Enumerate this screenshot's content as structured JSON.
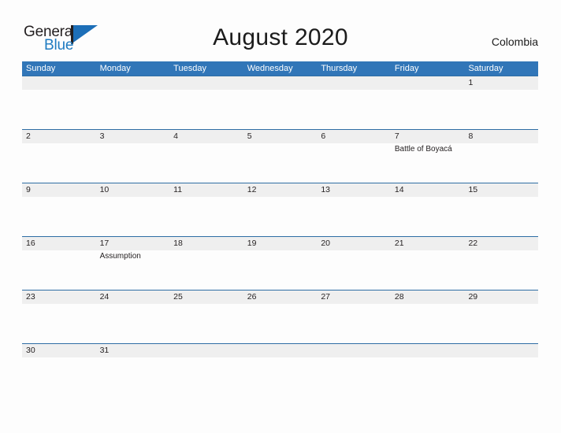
{
  "brand": {
    "name_part1": "General",
    "name_part2": "Blue",
    "logo_icon": "general-blue-flag-logo",
    "accent_color": "#1d6fb8"
  },
  "header": {
    "title": "August 2020",
    "country": "Colombia"
  },
  "calendar": {
    "month": "August",
    "year": "2020",
    "header_bg": "#3176b8",
    "date_strip_bg": "#efefef",
    "row_border_color": "#2e6da4",
    "weekdays": [
      "Sunday",
      "Monday",
      "Tuesday",
      "Wednesday",
      "Thursday",
      "Friday",
      "Saturday"
    ],
    "weeks": [
      {
        "dates": [
          "",
          "",
          "",
          "",
          "",
          "",
          "1"
        ],
        "events": [
          "",
          "",
          "",
          "",
          "",
          "",
          ""
        ]
      },
      {
        "dates": [
          "2",
          "3",
          "4",
          "5",
          "6",
          "7",
          "8"
        ],
        "events": [
          "",
          "",
          "",
          "",
          "",
          "Battle of Boyacá",
          ""
        ]
      },
      {
        "dates": [
          "9",
          "10",
          "11",
          "12",
          "13",
          "14",
          "15"
        ],
        "events": [
          "",
          "",
          "",
          "",
          "",
          "",
          ""
        ]
      },
      {
        "dates": [
          "16",
          "17",
          "18",
          "19",
          "20",
          "21",
          "22"
        ],
        "events": [
          "",
          "Assumption",
          "",
          "",
          "",
          "",
          ""
        ]
      },
      {
        "dates": [
          "23",
          "24",
          "25",
          "26",
          "27",
          "28",
          "29"
        ],
        "events": [
          "",
          "",
          "",
          "",
          "",
          "",
          ""
        ]
      },
      {
        "dates": [
          "30",
          "31",
          "",
          "",
          "",
          "",
          ""
        ],
        "events": [
          "",
          "",
          "",
          "",
          "",
          "",
          ""
        ]
      }
    ]
  }
}
